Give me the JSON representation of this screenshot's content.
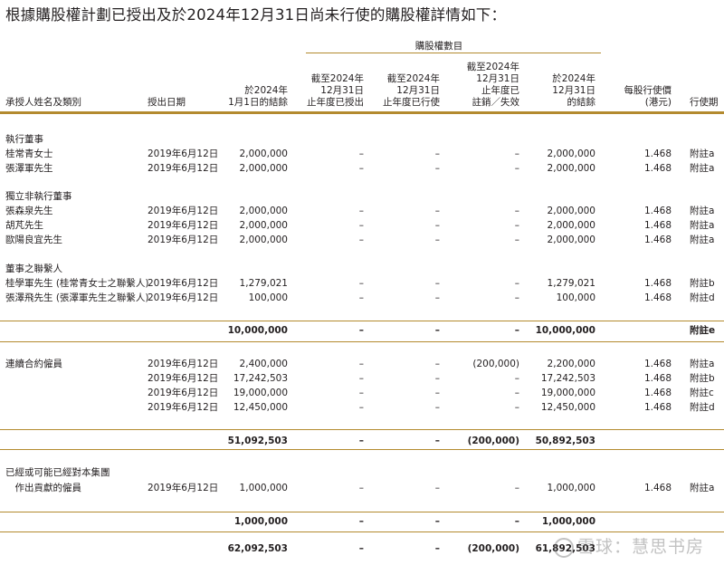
{
  "intro": "根據購股權計劃已授出及於2024年12月31日尚未行使的購股權詳情如下：",
  "group_title": "購股權數目",
  "headers": {
    "name": "承授人姓名及類別",
    "date": "授出日期",
    "open": [
      "於2024年",
      "1月1日的結餘"
    ],
    "granted": [
      "截至2024年",
      "12月31日",
      "止年度已授出"
    ],
    "exercised": [
      "截至2024年",
      "12月31日",
      "止年度已行使"
    ],
    "cancelled": [
      "截至2024年",
      "12月31日",
      "止年度已",
      "註銷／失效"
    ],
    "close": [
      "於2024年",
      "12月31日",
      "的結餘"
    ],
    "price": [
      "每股行使價",
      "(港元)"
    ],
    "period": "行使期"
  },
  "rows": [
    {
      "name": "執行董事"
    },
    {
      "name": "桂常青女士",
      "date": "2019年6月12日",
      "open": "2,000,000",
      "granted": "–",
      "exercised": "–",
      "cancelled": "–",
      "close": "2,000,000",
      "price": "1.468",
      "period": "附註a"
    },
    {
      "name": "張澤軍先生",
      "date": "2019年6月12日",
      "open": "2,000,000",
      "granted": "–",
      "exercised": "–",
      "cancelled": "–",
      "close": "2,000,000",
      "price": "1.468",
      "period": "附註a"
    },
    {
      "name": "獨立非執行董事"
    },
    {
      "name": "張森泉先生",
      "date": "2019年6月12日",
      "open": "2,000,000",
      "granted": "–",
      "exercised": "–",
      "cancelled": "–",
      "close": "2,000,000",
      "price": "1.468",
      "period": "附註a"
    },
    {
      "name": "胡芃先生",
      "date": "2019年6月12日",
      "open": "2,000,000",
      "granted": "–",
      "exercised": "–",
      "cancelled": "–",
      "close": "2,000,000",
      "price": "1.468",
      "period": "附註a"
    },
    {
      "name": "歐陽良宜先生",
      "date": "2019年6月12日",
      "open": "2,000,000",
      "granted": "–",
      "exercised": "–",
      "cancelled": "–",
      "close": "2,000,000",
      "price": "1.468",
      "period": "附註a"
    },
    {
      "name": "董事之聯繫人"
    },
    {
      "name": "桂學軍先生 (桂常青女士之聯繫人)",
      "date": "2019年6月12日",
      "open": "1,279,021",
      "granted": "–",
      "exercised": "–",
      "cancelled": "–",
      "close": "1,279,021",
      "price": "1.468",
      "period": "附註b"
    },
    {
      "name": "張澤飛先生 (張澤軍先生之聯繫人)",
      "date": "2019年6月12日",
      "open": "100,000",
      "granted": "–",
      "exercised": "–",
      "cancelled": "–",
      "close": "100,000",
      "price": "1.468",
      "period": "附註d"
    },
    {
      "bold": true,
      "open": "10,000,000",
      "granted": "–",
      "exercised": "–",
      "cancelled": "–",
      "close": "10,000,000",
      "period": "附註e"
    },
    {
      "name": "連續合約僱員",
      "date": "2019年6月12日",
      "open": "2,400,000",
      "granted": "–",
      "exercised": "–",
      "cancelled": "(200,000)",
      "close": "2,200,000",
      "price": "1.468",
      "period": "附註a"
    },
    {
      "date": "2019年6月12日",
      "open": "17,242,503",
      "granted": "–",
      "exercised": "–",
      "cancelled": "–",
      "close": "17,242,503",
      "price": "1.468",
      "period": "附註b"
    },
    {
      "date": "2019年6月12日",
      "open": "19,000,000",
      "granted": "–",
      "exercised": "–",
      "cancelled": "–",
      "close": "19,000,000",
      "price": "1.468",
      "period": "附註c"
    },
    {
      "date": "2019年6月12日",
      "open": "12,450,000",
      "granted": "–",
      "exercised": "–",
      "cancelled": "–",
      "close": "12,450,000",
      "price": "1.468",
      "period": "附註d"
    },
    {
      "bold": true,
      "open": "51,092,503",
      "granted": "–",
      "exercised": "–",
      "cancelled": "(200,000)",
      "close": "50,892,503"
    },
    {
      "name": "已經或可能已經對本集團"
    },
    {
      "name": "　作出貢獻的僱員",
      "date": "2019年6月12日",
      "open": "1,000,000",
      "granted": "–",
      "exercised": "–",
      "cancelled": "–",
      "close": "1,000,000",
      "price": "1.468",
      "period": "附註a"
    },
    {
      "bold": true,
      "open": "1,000,000",
      "granted": "–",
      "exercised": "–",
      "cancelled": "–",
      "close": "1,000,000"
    },
    {
      "bold": true,
      "open": "62,092,503",
      "granted": "–",
      "exercised": "–",
      "cancelled": "(200,000)",
      "close": "61,892,503"
    }
  ],
  "watermark": "雪球：慧思书房",
  "accent_color": "#b38a2e"
}
